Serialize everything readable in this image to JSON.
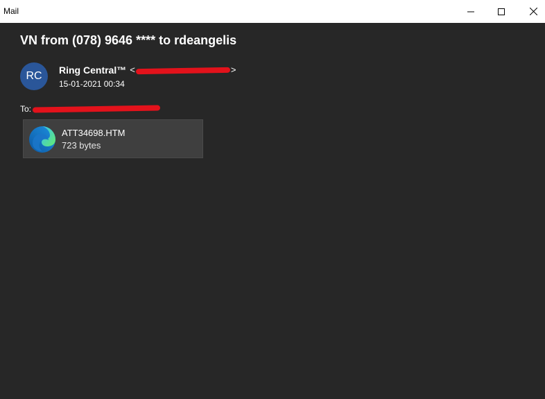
{
  "window": {
    "app_title": "Mail",
    "controls": {
      "minimize": "minimize",
      "maximize": "maximize",
      "close": "close"
    }
  },
  "message": {
    "subject": "VN from (078) 9646 **** to rdeangelis",
    "sender": {
      "avatar_initials": "RC",
      "name": "Ring Central™",
      "email_open": "<",
      "email_close": ">",
      "date": "15-01-2021 00:34"
    },
    "recipient": {
      "label": "To:"
    },
    "attachment": {
      "icon": "edge-browser-icon",
      "file_name": "ATT34698.HTM",
      "file_size": "723 bytes"
    }
  },
  "colors": {
    "background": "#272727",
    "titlebar": "#ffffff",
    "avatar": "#2a5699",
    "attachment_card": "#3f3f3f",
    "redaction": "#e3121b"
  }
}
